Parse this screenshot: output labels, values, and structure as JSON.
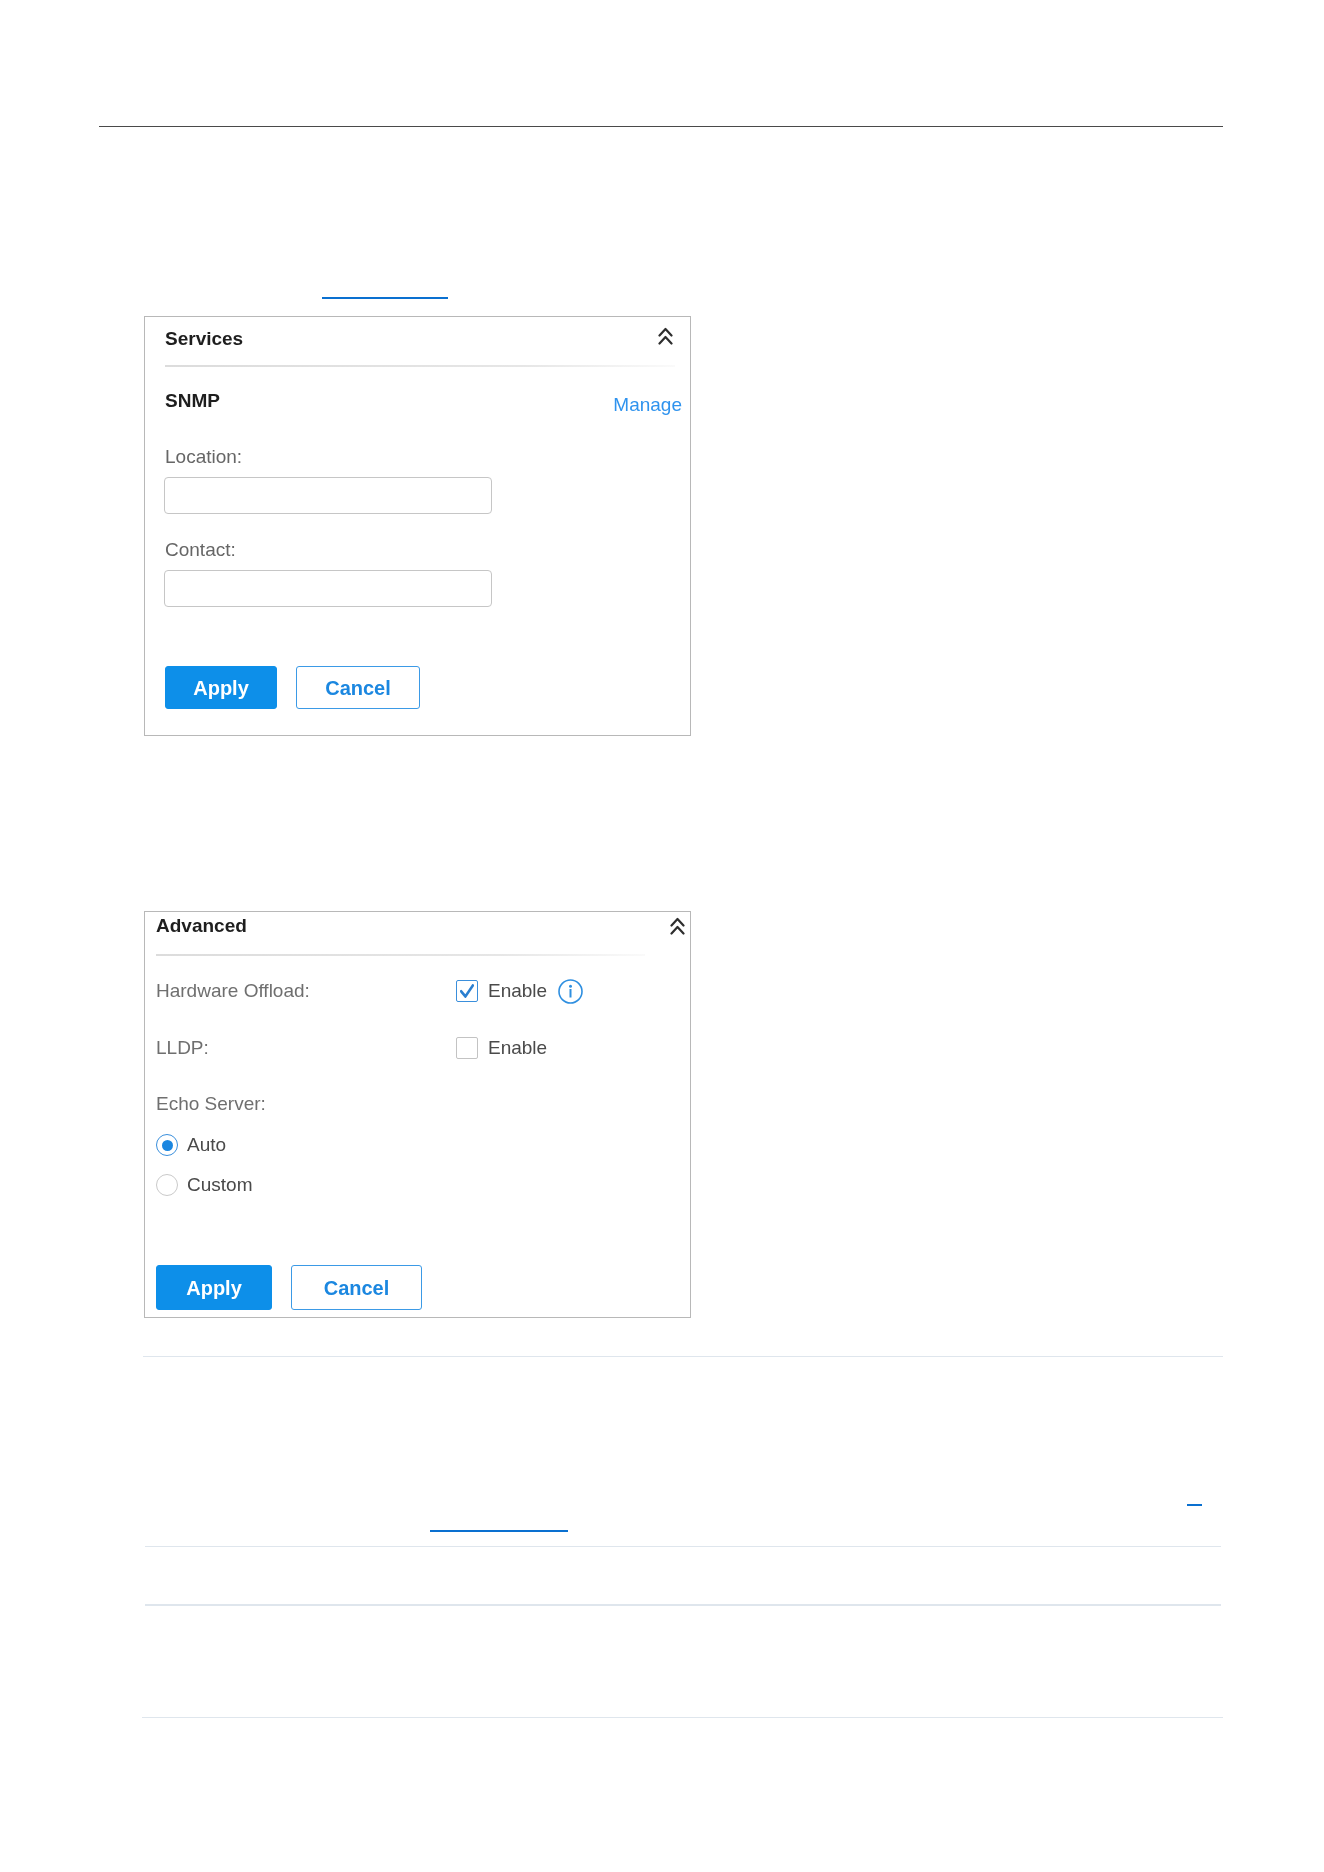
{
  "panels": [
    {
      "title": "Services",
      "expanded": true,
      "rows": [
        {
          "kind": "subheading",
          "text": "SNMP",
          "link": "Manage"
        },
        {
          "kind": "text-field",
          "label": "Location:"
        },
        {
          "kind": "text-field",
          "label": "Contact:"
        }
      ],
      "buttons": [
        {
          "label": "Apply",
          "kind": "primary"
        },
        {
          "label": "Cancel",
          "kind": "secondary"
        }
      ]
    },
    {
      "title": "Advanced",
      "expanded": true,
      "rows": [
        {
          "kind": "checkbox",
          "label": "Hardware Offload:",
          "option": "Enable",
          "checked": true,
          "info": true
        },
        {
          "kind": "checkbox",
          "label": "LLDP:",
          "option": "Enable",
          "checked": false,
          "info": false
        },
        {
          "kind": "radio-group",
          "label": "Echo Server:",
          "choices": [
            {
              "label": "Auto",
              "selected": true
            },
            {
              "label": "Custom",
              "selected": false
            }
          ]
        }
      ],
      "buttons": [
        {
          "label": "Apply",
          "kind": "primary"
        },
        {
          "label": "Cancel",
          "kind": "secondary"
        }
      ]
    }
  ]
}
